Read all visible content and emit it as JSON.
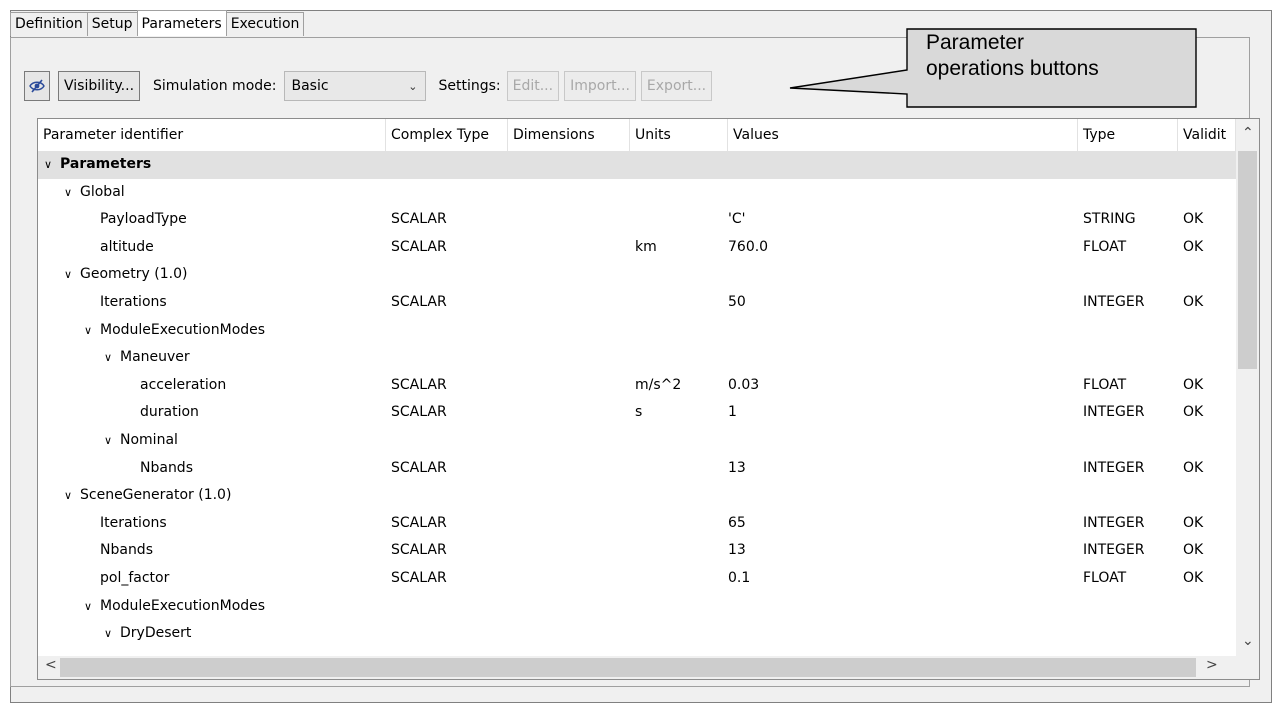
{
  "tabs": [
    {
      "label": "Definition",
      "active": false
    },
    {
      "label": "Setup",
      "active": false
    },
    {
      "label": "Parameters",
      "active": true
    },
    {
      "label": "Execution",
      "active": false
    }
  ],
  "toolbar": {
    "visibility_icon": "eye-slash-icon",
    "visibility_label": "Visibility...",
    "simulation_mode_label": "Simulation mode:",
    "simulation_mode_value": "Basic",
    "settings_label": "Settings:",
    "edit_label": "Edit...",
    "import_label": "Import...",
    "export_label": "Export..."
  },
  "callout": {
    "line1": "Parameter",
    "line2": "operations buttons"
  },
  "table": {
    "columns": [
      "Parameter identifier",
      "Complex Type",
      "Dimensions",
      "Units",
      "Values",
      "Type",
      "Validit"
    ],
    "rows": [
      {
        "indent": 0,
        "expander": "open",
        "name": "Parameters",
        "bold": true,
        "selected": true,
        "complex": "",
        "dims": "",
        "units": "",
        "value": "",
        "type": "",
        "validity": ""
      },
      {
        "indent": 1,
        "expander": "open",
        "name": "Global",
        "complex": "",
        "dims": "",
        "units": "",
        "value": "",
        "type": "",
        "validity": ""
      },
      {
        "indent": 2,
        "expander": "",
        "name": "PayloadType",
        "complex": "SCALAR",
        "dims": "",
        "units": "",
        "value": "'C'",
        "type": "STRING",
        "validity": "OK"
      },
      {
        "indent": 2,
        "expander": "",
        "name": "altitude",
        "complex": "SCALAR",
        "dims": "",
        "units": "km",
        "value": "760.0",
        "type": "FLOAT",
        "validity": "OK"
      },
      {
        "indent": 1,
        "expander": "open",
        "name": "Geometry (1.0)",
        "complex": "",
        "dims": "",
        "units": "",
        "value": "",
        "type": "",
        "validity": ""
      },
      {
        "indent": 2,
        "expander": "",
        "name": "Iterations",
        "complex": "SCALAR",
        "dims": "",
        "units": "",
        "value": "50",
        "type": "INTEGER",
        "validity": "OK"
      },
      {
        "indent": 2,
        "expander": "open",
        "name": "ModuleExecutionModes",
        "complex": "",
        "dims": "",
        "units": "",
        "value": "",
        "type": "",
        "validity": ""
      },
      {
        "indent": 3,
        "expander": "open",
        "name": "Maneuver",
        "complex": "",
        "dims": "",
        "units": "",
        "value": "",
        "type": "",
        "validity": ""
      },
      {
        "indent": 4,
        "expander": "",
        "name": "acceleration",
        "complex": "SCALAR",
        "dims": "",
        "units": "m/s^2",
        "value": "0.03",
        "type": "FLOAT",
        "validity": "OK"
      },
      {
        "indent": 4,
        "expander": "",
        "name": "duration",
        "complex": "SCALAR",
        "dims": "",
        "units": "s",
        "value": "1",
        "type": "INTEGER",
        "validity": "OK"
      },
      {
        "indent": 3,
        "expander": "open",
        "name": "Nominal",
        "complex": "",
        "dims": "",
        "units": "",
        "value": "",
        "type": "",
        "validity": ""
      },
      {
        "indent": 4,
        "expander": "",
        "name": "Nbands",
        "complex": "SCALAR",
        "dims": "",
        "units": "",
        "value": "13",
        "type": "INTEGER",
        "validity": "OK"
      },
      {
        "indent": 1,
        "expander": "open",
        "name": "SceneGenerator (1.0)",
        "complex": "",
        "dims": "",
        "units": "",
        "value": "",
        "type": "",
        "validity": ""
      },
      {
        "indent": 2,
        "expander": "",
        "name": "Iterations",
        "complex": "SCALAR",
        "dims": "",
        "units": "",
        "value": "65",
        "type": "INTEGER",
        "validity": "OK"
      },
      {
        "indent": 2,
        "expander": "",
        "name": "Nbands",
        "complex": "SCALAR",
        "dims": "",
        "units": "",
        "value": "13",
        "type": "INTEGER",
        "validity": "OK"
      },
      {
        "indent": 2,
        "expander": "",
        "name": "pol_factor",
        "complex": "SCALAR",
        "dims": "",
        "units": "",
        "value": "0.1",
        "type": "FLOAT",
        "validity": "OK"
      },
      {
        "indent": 2,
        "expander": "open",
        "name": "ModuleExecutionModes",
        "complex": "",
        "dims": "",
        "units": "",
        "value": "",
        "type": "",
        "validity": ""
      },
      {
        "indent": 3,
        "expander": "open",
        "name": "DryDesert",
        "complex": "",
        "dims": "",
        "units": "",
        "value": "",
        "type": "",
        "validity": ""
      }
    ]
  }
}
